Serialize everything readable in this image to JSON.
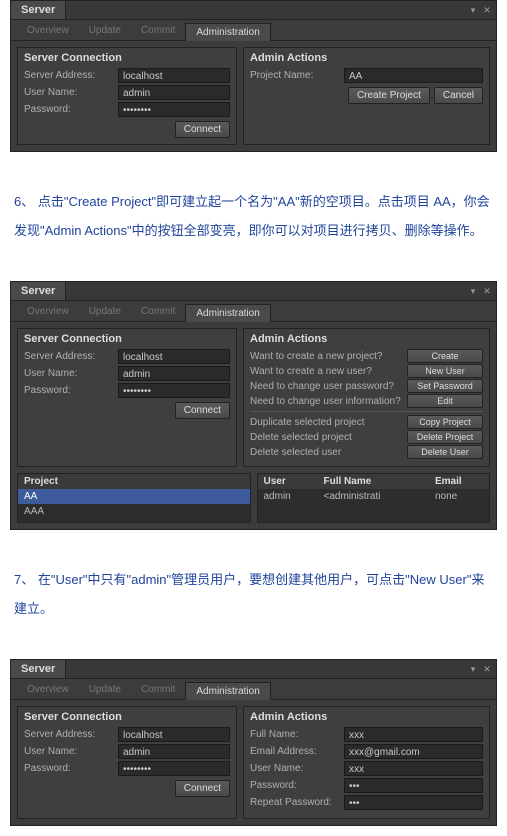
{
  "common": {
    "window_title": "Server",
    "subtabs": [
      "Overview",
      "Update",
      "Commit",
      "Administration"
    ],
    "conn_title": "Server Connection",
    "admin_title": "Admin Actions",
    "server_addr_label": "Server Address:",
    "server_addr_value": "localhost",
    "user_label": "User Name:",
    "user_value": "admin",
    "pass_label": "Password:",
    "pass_value": "••••••••",
    "connect_btn": "Connect"
  },
  "panel1": {
    "project_name_label": "Project Name:",
    "project_name_value": "AA",
    "create_btn": "Create Project",
    "cancel_btn": "Cancel"
  },
  "para1": "6、 点击\"Create Project\"即可建立起一个名为\"AA\"新的空项目。点击项目 AA，你会发现\"Admin Actions\"中的按钮全部变亮，即你可以对项目进行拷贝、删除等操作。",
  "panel2": {
    "actions": [
      {
        "label": "Want to create a new project?",
        "btn": "Create"
      },
      {
        "label": "Want to create a new user?",
        "btn": "New User"
      },
      {
        "label": "Need to change user password?",
        "btn": "Set Password"
      },
      {
        "label": "Need to change user information?",
        "btn": "Edit"
      },
      {
        "label": "Duplicate selected project",
        "btn": "Copy Project"
      },
      {
        "label": "Delete selected project",
        "btn": "Delete Project"
      },
      {
        "label": "Delete selected user",
        "btn": "Delete User"
      }
    ],
    "project_header": "Project",
    "projects": [
      "AA",
      "AAA"
    ],
    "user_headers": {
      "user": "User",
      "full": "Full Name",
      "email": "Email"
    },
    "users": [
      {
        "user": "admin",
        "full": "<administrati",
        "email": "none"
      }
    ]
  },
  "para2": "7、 在\"User\"中只有\"admin\"管理员用户，要想创建其他用户，可点击\"New User\"来建立。",
  "panel3": {
    "full_name_label": "Full Name:",
    "full_name_value": "xxx",
    "email_label": "Email Address:",
    "email_value": "xxx@gmail.com",
    "new_user_label": "User Name:",
    "new_user_value": "xxx",
    "new_pass_label": "Password:",
    "new_pass_value": "•••",
    "repeat_label": "Repeat Password:",
    "repeat_value": "•••"
  }
}
